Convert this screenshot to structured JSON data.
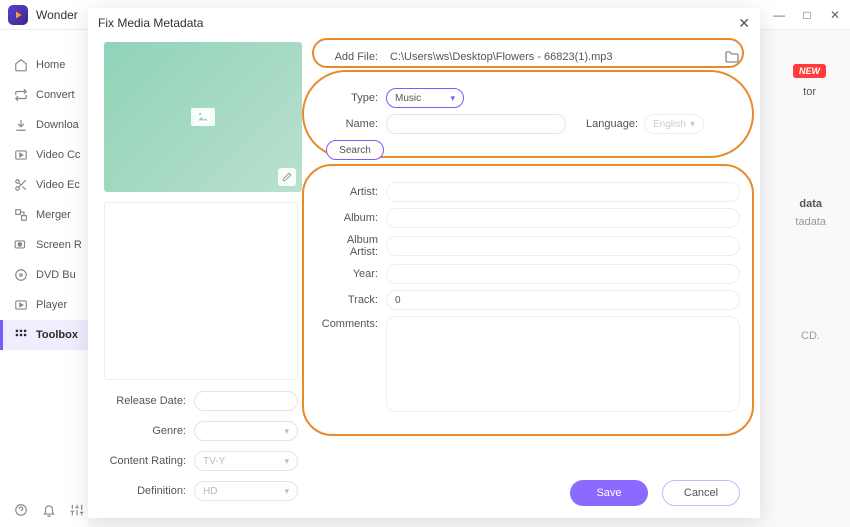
{
  "app": {
    "name": "Wonder"
  },
  "window_controls": {
    "min": "—",
    "max": "□",
    "close": "✕"
  },
  "sidebar": {
    "items": [
      {
        "label": "Home"
      },
      {
        "label": "Convert"
      },
      {
        "label": "Downloa"
      },
      {
        "label": "Video Cc"
      },
      {
        "label": "Video Ec"
      },
      {
        "label": "Merger"
      },
      {
        "label": "Screen R"
      },
      {
        "label": "DVD Bu"
      },
      {
        "label": "Player"
      },
      {
        "label": "Toolbox"
      }
    ]
  },
  "bg": {
    "new": "NEW",
    "tor": "tor",
    "data": "data",
    "tadata": "tadata",
    "cd": "CD."
  },
  "modal": {
    "title": "Fix Media Metadata",
    "add_file_label": "Add File:",
    "file_path": "C:\\Users\\ws\\Desktop\\Flowers - 66823(1).mp3",
    "type_label": "Type:",
    "type_value": "Music",
    "name_label": "Name:",
    "language_label": "Language:",
    "language_value": "English",
    "search_label": "Search",
    "fields": {
      "artist": "Artist:",
      "album": "Album:",
      "album_artist": "Album Artist:",
      "year": "Year:",
      "track": "Track:",
      "track_value": "0",
      "comments": "Comments:"
    },
    "left": {
      "release_date": "Release Date:",
      "genre": "Genre:",
      "content_rating": "Content Rating:",
      "content_rating_value": "TV-Y",
      "definition": "Definition:",
      "definition_value": "HD"
    },
    "save": "Save",
    "cancel": "Cancel"
  }
}
